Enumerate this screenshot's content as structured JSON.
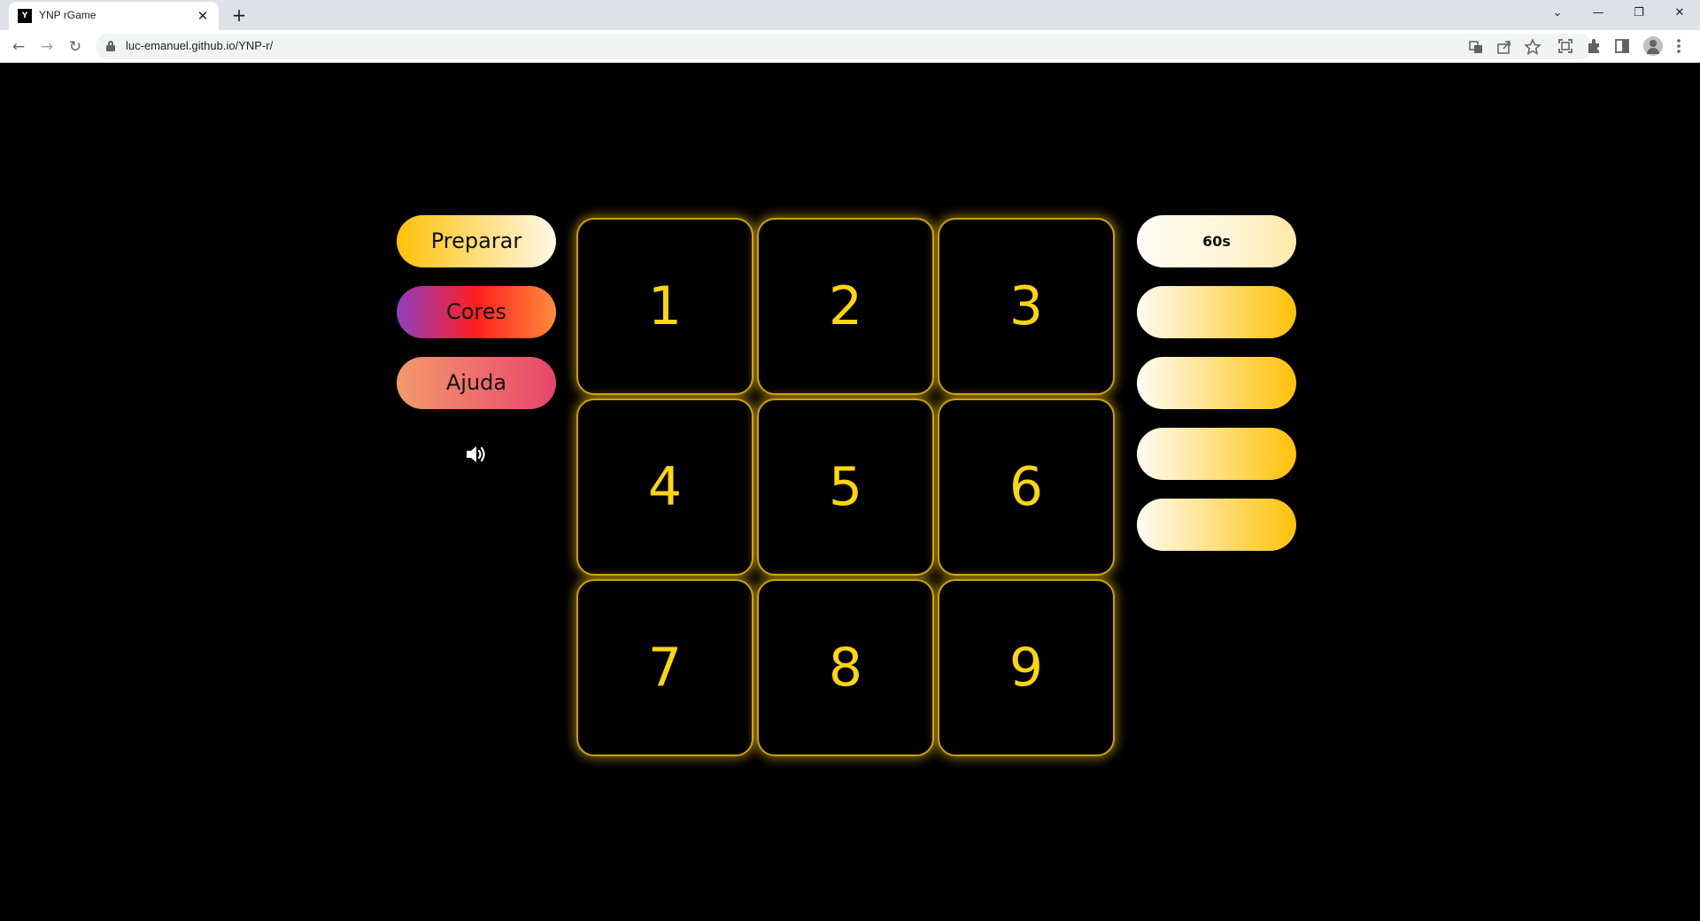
{
  "browser": {
    "tab_title": "YNP rGame",
    "favicon_text": "Y",
    "tab_close": "✕",
    "new_tab": "+",
    "url": "luc-emanuel.github.io/YNP-r/",
    "controls": {
      "dropdown": "⌄",
      "minimize": "—",
      "restore": "❐",
      "close": "✕"
    },
    "nav": {
      "back": "←",
      "forward": "→",
      "reload": "↻"
    },
    "icons": [
      "translate-icon",
      "share-icon",
      "bookmark-star-icon",
      "screenshot-icon",
      "extensions-icon",
      "side-panel-icon",
      "profile-icon",
      "menu-icon"
    ]
  },
  "left_menu": {
    "preparar": "Preparar",
    "cores": "Cores",
    "ajuda": "Ajuda"
  },
  "grid": {
    "cells": [
      "1",
      "2",
      "3",
      "4",
      "5",
      "6",
      "7",
      "8",
      "9"
    ]
  },
  "right_panel": {
    "timer": "60s",
    "slots": [
      "",
      "",
      "",
      ""
    ]
  },
  "colors": {
    "background": "#000000",
    "cell_border": "#c9a100",
    "cell_text": "#ffd60a",
    "accent": "#ffc107"
  }
}
